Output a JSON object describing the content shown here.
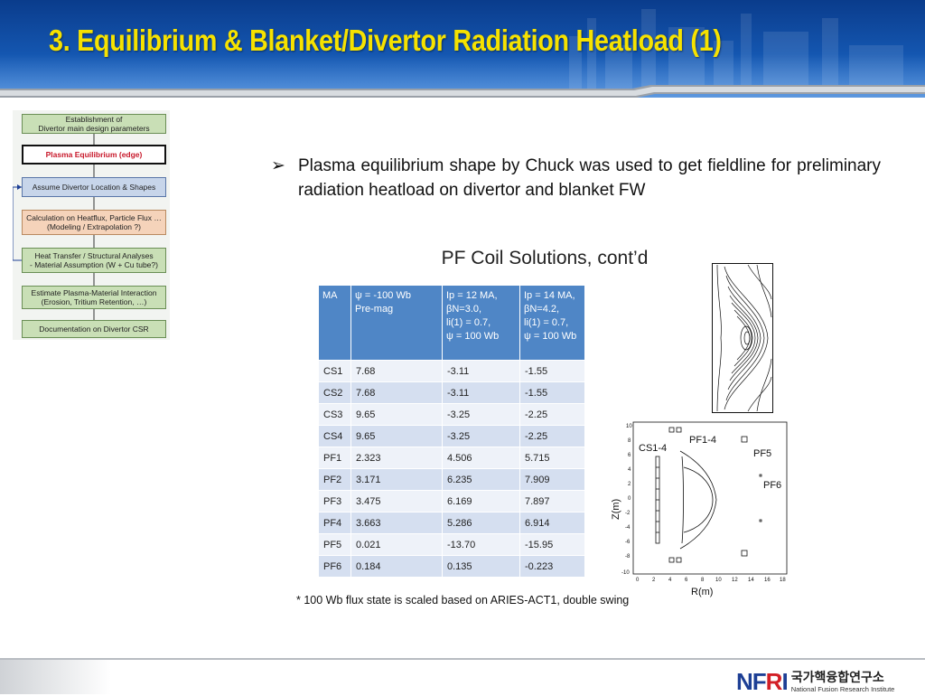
{
  "slide": {
    "title": "3. Equilibrium & Blanket/Divertor Radiation Heatload  (1)",
    "bullet_symbol": "➢",
    "bullet_text": "Plasma equilibrium shape by Chuck was used to get fieldline for preliminary radiation heatload on divertor and blanket FW"
  },
  "flowchart": {
    "boxes": [
      {
        "label": "Establishment of\nDivertor main design parameters",
        "style": "green"
      },
      {
        "label": "Plasma Equilibrium (edge)",
        "style": "active"
      },
      {
        "label": "Assume Divertor Location & Shapes",
        "style": "blue"
      },
      {
        "label": "Calculation on Heatflux, Particle Flux …\n(Modeling / Extrapolation ?)",
        "style": "orange"
      },
      {
        "label": "Heat Transfer / Structural Analyses\n- Material Assumption (W + Cu tube?)",
        "style": "green"
      },
      {
        "label": "Estimate Plasma-Material Interaction\n(Erosion, Tritium Retention, …)",
        "style": "green"
      },
      {
        "label": "Documentation on Divertor CSR",
        "style": "green"
      }
    ]
  },
  "panel": {
    "title": "PF Coil Solutions, cont’d",
    "table": {
      "headers": [
        "MA",
        "ψ = -100 Wb\nPre-mag",
        "Ip = 12 MA,\nβN=3.0,\n li(1) = 0.7,\nψ = 100 Wb",
        "Ip = 14 MA,\nβN=4.2,\n li(1) = 0.7,\nψ = 100 Wb"
      ],
      "rows": [
        [
          "CS1",
          "7.68",
          "-3.11",
          "-1.55"
        ],
        [
          "CS2",
          "7.68",
          "-3.11",
          "-1.55"
        ],
        [
          "CS3",
          "9.65",
          "-3.25",
          "-2.25"
        ],
        [
          "CS4",
          "9.65",
          "-3.25",
          "-2.25"
        ],
        [
          "PF1",
          "2.323",
          "4.506",
          "5.715"
        ],
        [
          "PF2",
          "3.171",
          "6.235",
          "7.909"
        ],
        [
          "PF3",
          "3.475",
          "6.169",
          "7.897"
        ],
        [
          "PF4",
          "3.663",
          "5.286",
          "6.914"
        ],
        [
          "PF5",
          "0.021",
          "-13.70",
          "-15.95"
        ],
        [
          "PF6",
          "0.184",
          "0.135",
          "-0.223"
        ]
      ]
    },
    "footnote": "* 100 Wb flux state is scaled based on ARIES-ACT1, double swing",
    "coil_plot": {
      "xlabel": "R(m)",
      "ylabel": "Z(m)",
      "x_ticks": [
        "0",
        "2",
        "4",
        "6",
        "8",
        "10",
        "12",
        "14",
        "16",
        "18"
      ],
      "y_ticks": [
        "10",
        "8",
        "6",
        "4",
        "2",
        "0",
        "-2",
        "-4",
        "-6",
        "-8",
        "-10"
      ],
      "labels": {
        "cs": "CS1-4",
        "pf14": "PF1-4",
        "pf5": "PF5",
        "pf6": "PF6"
      }
    }
  },
  "footer": {
    "logo_mark_a": "NF",
    "logo_mark_b": "R",
    "logo_mark_c": "I",
    "org_korean": "국가핵융합연구소",
    "org_english": "National Fusion Research Institute"
  },
  "colors": {
    "title": "#f6e200",
    "header": "#1456b0",
    "table_header": "#4f86c6",
    "highlight": "#c8182a"
  }
}
